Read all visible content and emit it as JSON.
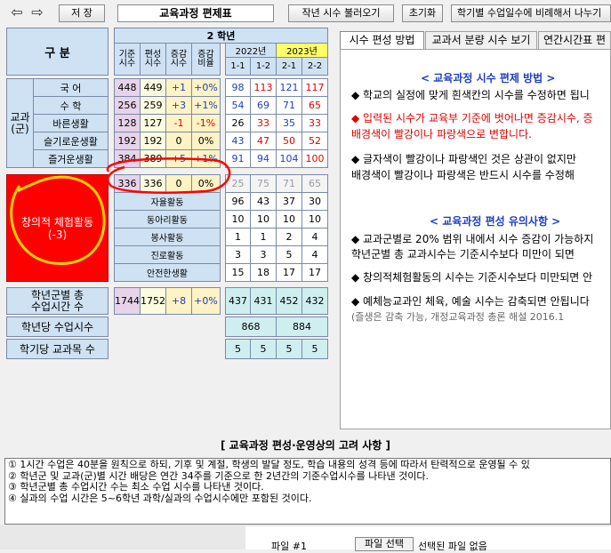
{
  "toolbar": {
    "back_icon": "back-arrow-icon",
    "forward_icon": "forward-arrow-icon",
    "save": "저 장",
    "title": "교육과정 편제표",
    "load_prev": "작년 시수 불러오기",
    "reset": "초기화",
    "proportional": "학기별 수업일수에 비례해서 나누기"
  },
  "table": {
    "header": {
      "category": "구    분",
      "grade": "2 학년",
      "base": "기준\n시수",
      "edit": "편성\n시수",
      "delta": "증감\n시수",
      "ratio": "증감\n비율",
      "year1": "2022년",
      "year2": "2023년",
      "terms": [
        "1-1",
        "1-2",
        "2-1",
        "2-2"
      ]
    },
    "group_label": "교과\n(군)",
    "subjects": [
      {
        "name": "국 어",
        "base": "448",
        "edit": "449",
        "delta": "+1",
        "ratio": "+0%",
        "t": [
          "98",
          "113",
          "121",
          "117"
        ],
        "tc": [
          "blu",
          "red",
          "blu",
          "red"
        ]
      },
      {
        "name": "수 학",
        "base": "256",
        "edit": "259",
        "delta": "+3",
        "ratio": "+1%",
        "t": [
          "54",
          "69",
          "71",
          "65"
        ],
        "tc": [
          "blu",
          "blu",
          "blu",
          "red"
        ]
      },
      {
        "name": "바른생활",
        "base": "128",
        "edit": "127",
        "delta": "-1",
        "ratio": "-1%",
        "t": [
          "26",
          "33",
          "35",
          "33"
        ],
        "tc": [
          "",
          "red",
          "blu",
          "red"
        ]
      },
      {
        "name": "슬기로운생활",
        "base": "192",
        "edit": "192",
        "delta": "0",
        "ratio": "0%",
        "t": [
          "43",
          "47",
          "50",
          "52"
        ],
        "tc": [
          "blu",
          "red",
          "red",
          "red"
        ]
      },
      {
        "name": "즐거운생활",
        "base": "384",
        "edit": "389",
        "delta": "+5",
        "ratio": "+1%",
        "t": [
          "91",
          "94",
          "104",
          "100"
        ],
        "tc": [
          "blu",
          "blu",
          "blu",
          "red"
        ]
      }
    ],
    "creative": {
      "label": "창의적 체험활동",
      "sub": "(-3)",
      "base": "336",
      "edit": "336",
      "delta": "0",
      "ratio": "0%",
      "t": [
        "25",
        "75",
        "71",
        "65"
      ],
      "acts": [
        {
          "name": "자율활동",
          "t": [
            "96",
            "43",
            "37",
            "30"
          ]
        },
        {
          "name": "동아리활동",
          "t": [
            "10",
            "10",
            "10",
            "10"
          ]
        },
        {
          "name": "봉사활동",
          "t": [
            "1",
            "1",
            "2",
            "4"
          ]
        },
        {
          "name": "진로활동",
          "t": [
            "3",
            "3",
            "5",
            "4"
          ]
        },
        {
          "name": "안전한생활",
          "t": [
            "15",
            "18",
            "17",
            "17"
          ]
        }
      ]
    },
    "totals": {
      "total_label": "학년군별 총\n수업시간 수",
      "base": "1744",
      "edit": "1752",
      "delta": "+8",
      "ratio": "+0%",
      "t": [
        "437",
        "431",
        "452",
        "432"
      ],
      "annual_label": "학년당 수업시수",
      "annual": [
        "868",
        "884"
      ],
      "subjects_label": "학기당 교과목 수",
      "subjects": [
        "5",
        "5",
        "5",
        "5"
      ]
    }
  },
  "tabs": [
    "시수 편성 방법",
    "교과서 분량 시수 보기",
    "연간시간표 편"
  ],
  "panel": {
    "title1": "< 교육과정 시수 편제 방법 >",
    "items1": [
      {
        "text": "◆ 학교의 실정에 맞게 흰색칸의 시수를 수정하면 됩니",
        "cls": ""
      },
      {
        "text": "◆ 입력된 시수가 교육부 기준에 벗어나면 증감시수, 증",
        "cls": "bullet-red"
      },
      {
        "text": "    배경색이 빨강이나 파랑색으로 변합니다.",
        "cls": "bullet-red"
      },
      {
        "text": "◆ 글자색이 빨강이나 파랑색인 것은 상관이 없지만",
        "cls": ""
      },
      {
        "text": "    배경색이 빨강이나 파랑색은 반드시 시수를 수정해",
        "cls": ""
      }
    ],
    "title2": "< 교육과정 편성 유의사항 >",
    "items2": [
      {
        "text": "◆ 교과군별로 20% 범위 내에서 시수 증감이 가능하지",
        "cls": ""
      },
      {
        "text": "    학년군별 총 교과시수는 기준시수보다 미만이 되면",
        "cls": ""
      },
      {
        "text": "◆ 창의적체험활동의 시수는 기준시수보다 미만되면 안",
        "cls": ""
      },
      {
        "text": "◆ 예체능교과인 체육, 예술 시수는 감축되면 안됩니다",
        "cls": ""
      },
      {
        "text": "    (즐생은 감축 가능, 개정교육과정 총론 해설 2016.1",
        "cls": "note"
      }
    ]
  },
  "bottom": {
    "title": "[ 교육과정 편성·운영상의 고려 사항 ]",
    "lines": [
      "① 1시간 수업은 40분을 원칙으로 하되, 기후 및 계절, 학생의 발달 정도, 학습 내용의 성격 등에 따라서 탄력적으로 운영될 수 있",
      "② 학년군 및 교과(군)별 시간 배당은 연간 34주를 기준으로 한 2년간의 기준수업시수를 나타낸 것이다.",
      "③ 학년군별 총 수업시간 수는 최소 수업 시수를 나타낸 것이다.",
      "④ 실과의 수업 시간은 5~6학년 과학/실과의 수업시수에만 포함된 것이다."
    ]
  },
  "footer": {
    "file_label": "파일 #1",
    "file_button": "파일 선택",
    "file_status": "선택된 파일 없음"
  },
  "colors": {
    "header_bg": "#cfe2f3",
    "creative_bg": "#ff0000",
    "annotation": "#ff0000",
    "highlight_2023": "#ffff66"
  }
}
